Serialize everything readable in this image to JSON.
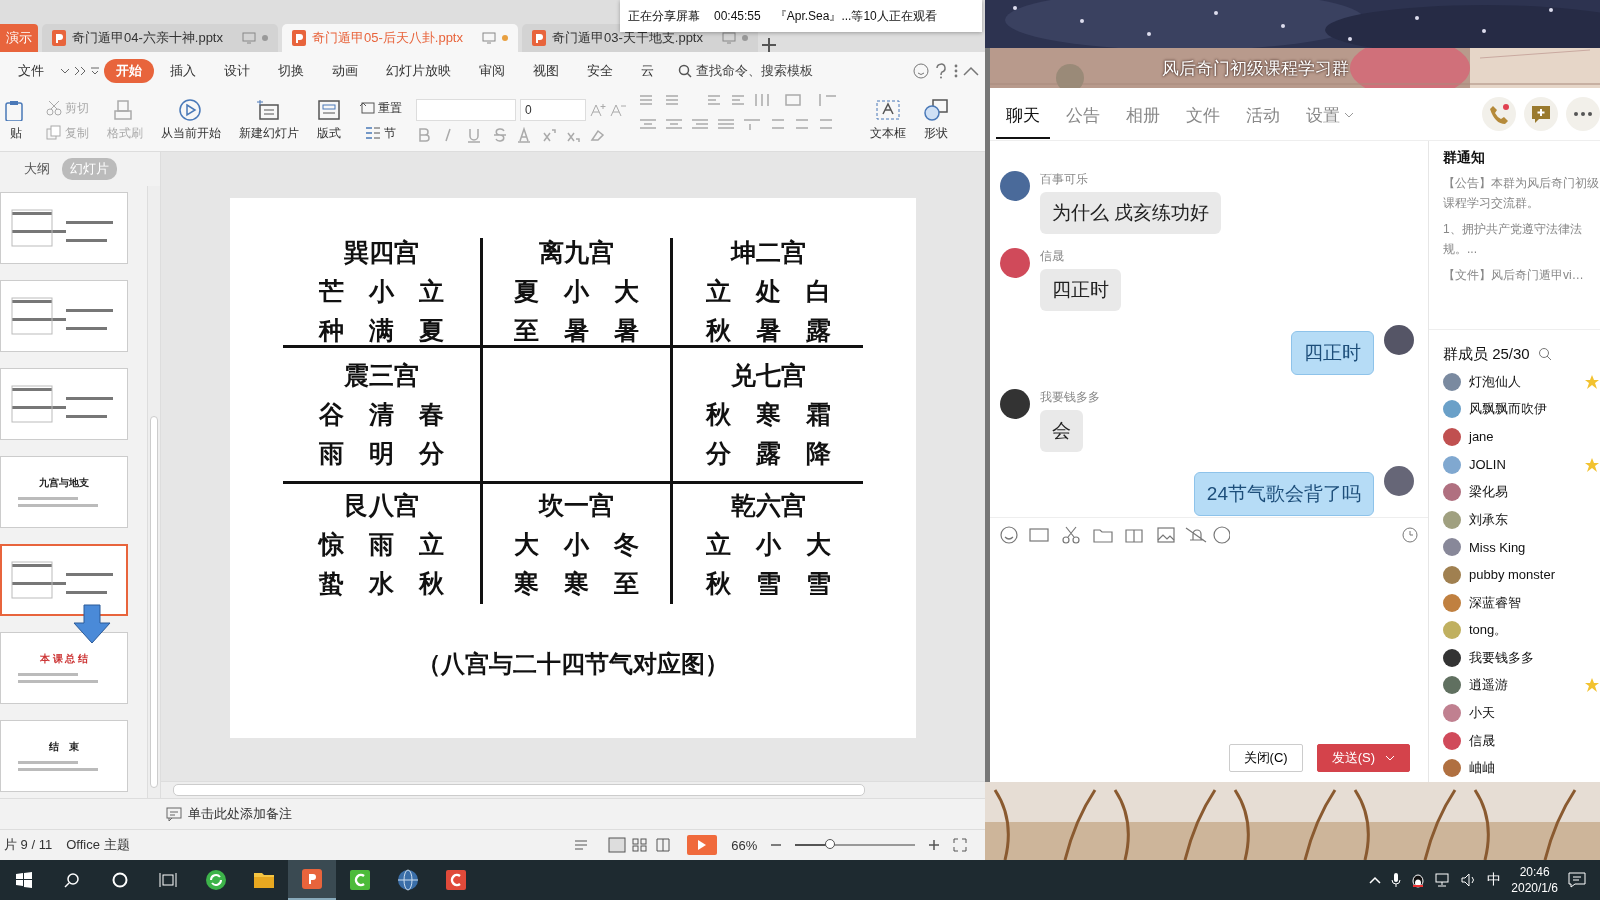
{
  "sharing_bar": {
    "status": "正在分享屏幕",
    "elapsed": "00:45:55",
    "viewers": "『Apr.Sea』...等10人正在观看"
  },
  "wps": {
    "app_tab": "演示",
    "doc_tabs": [
      {
        "title": "奇门遁甲04-六亲十神.pptx",
        "selected": false,
        "modified": false
      },
      {
        "title": "奇门遁甲05-后天八卦.pptx",
        "selected": true,
        "modified": true
      },
      {
        "title": "奇门遁甲03-天干地支.pptx",
        "selected": false,
        "modified": false
      }
    ],
    "menu": [
      {
        "label": "文件",
        "selected": false
      },
      {
        "label": "开始",
        "selected": true
      },
      {
        "label": "插入",
        "selected": false
      },
      {
        "label": "设计",
        "selected": false
      },
      {
        "label": "切换",
        "selected": false
      },
      {
        "label": "动画",
        "selected": false
      },
      {
        "label": "幻灯片放映",
        "selected": false
      },
      {
        "label": "审阅",
        "selected": false
      },
      {
        "label": "视图",
        "selected": false
      },
      {
        "label": "安全",
        "selected": false
      },
      {
        "label": "云",
        "selected": false
      }
    ],
    "search": {
      "placeholder": "查找命令、搜索模板"
    },
    "ribbon": [
      {
        "label": "贴",
        "kind": "large",
        "disabled": false
      },
      {
        "label": "剪切",
        "kind": "small",
        "disabled": true
      },
      {
        "label": "复制",
        "kind": "small",
        "disabled": true
      },
      {
        "label": "格式刷",
        "kind": "large",
        "disabled": true
      },
      {
        "label": "从当前开始",
        "kind": "large",
        "disabled": false
      },
      {
        "label": "新建幻灯片",
        "kind": "large",
        "disabled": false
      },
      {
        "label": "版式",
        "kind": "large",
        "disabled": false
      },
      {
        "label": "重置",
        "kind": "small",
        "disabled": false
      },
      {
        "label": "节",
        "kind": "small",
        "disabled": false
      },
      {
        "kind": "font",
        "size": "0"
      },
      {
        "kind": "paragraph"
      },
      {
        "label": "文本框",
        "kind": "large",
        "disabled": false
      },
      {
        "label": "形状",
        "kind": "large",
        "disabled": false
      }
    ],
    "pane_tabs": [
      {
        "label": "大纲",
        "selected": false
      },
      {
        "label": "幻灯片",
        "selected": true
      }
    ],
    "thumbnails": [
      {
        "selected": false
      },
      {
        "selected": false
      },
      {
        "selected": false
      },
      {
        "title": "九宫与地支",
        "selected": false
      },
      {
        "selected": true
      },
      {
        "title": "本 课 总 结",
        "selected": false
      },
      {
        "title": "结　束",
        "selected": false
      }
    ],
    "slide": {
      "cells": [
        {
          "kind": "palace",
          "title": "巽四宫",
          "lines": [
            "芒　小　立",
            "种　满　夏"
          ]
        },
        {
          "kind": "palace",
          "title": "离九宫",
          "lines": [
            "夏　小　大",
            "至　暑　暑"
          ]
        },
        {
          "kind": "palace",
          "title": "坤二宫",
          "lines": [
            "立　处　白",
            "秋　暑　露"
          ]
        },
        {
          "kind": "palace",
          "title": "震三宫",
          "lines": [
            "谷　清　春",
            "雨　明　分"
          ]
        },
        {
          "kind": "empty"
        },
        {
          "kind": "palace",
          "title": "兑七宫",
          "lines": [
            "秋　寒　霜",
            "分　露　降"
          ]
        },
        {
          "kind": "palace",
          "title": "艮八宫",
          "lines": [
            "惊　雨　立",
            "蛰　水　秋"
          ]
        },
        {
          "kind": "palace",
          "title": "坎一宫",
          "lines": [
            "大　小　冬",
            "寒　寒　至"
          ]
        },
        {
          "kind": "palace",
          "title": "乾六宫",
          "lines": [
            "立　小　大",
            "秋　雪　雪"
          ]
        }
      ],
      "caption": "（八宫与二十四节气对应图）"
    },
    "notes_placeholder": "单击此处添加备注",
    "status": {
      "slide_counter": "片 9 / 11",
      "theme": "Office 主题",
      "zoom": "66%",
      "level": 0.3
    }
  },
  "qq": {
    "group_title": "风后奇门初级课程学习群",
    "tabs": [
      {
        "label": "聊天",
        "selected": true
      },
      {
        "label": "公告",
        "selected": false
      },
      {
        "label": "相册",
        "selected": false
      },
      {
        "label": "文件",
        "selected": false
      },
      {
        "label": "活动",
        "selected": false
      },
      {
        "label": "设置",
        "selected": false
      }
    ],
    "messages": [
      {
        "sender": "百事可乐",
        "text": "为什么 戌亥练功好",
        "outgoing": false
      },
      {
        "sender": "信晟",
        "text": "四正时",
        "outgoing": false
      },
      {
        "text": "四正时",
        "outgoing": true
      },
      {
        "sender": "我要钱多多",
        "text": "会",
        "outgoing": false
      },
      {
        "text": "24节气歌会背了吗",
        "outgoing": true
      }
    ],
    "buttons": [
      {
        "label": "关闭(C)",
        "kind": "plain"
      },
      {
        "label": "发送(S)",
        "kind": "primary"
      }
    ],
    "notice": {
      "title": "群通知",
      "lines": [
        "【公告】本群为风后奇门初级课程学习交流群。",
        "1、拥护共产党遵守法律法规。...",
        "【文件】风后奇门遁甲vi…"
      ]
    },
    "members": {
      "title": "群成员 25/30",
      "items": [
        {
          "name": "灯泡仙人",
          "admin": true
        },
        {
          "name": "风飘飘而吹伊",
          "admin": false
        },
        {
          "name": "jane",
          "admin": false
        },
        {
          "name": "JOLIN",
          "admin": true
        },
        {
          "name": "梁化易",
          "admin": false
        },
        {
          "name": "刘承东",
          "admin": false
        },
        {
          "name": "Miss  King",
          "admin": false
        },
        {
          "name": "pubby monster",
          "admin": false
        },
        {
          "name": "深蓝睿智",
          "admin": false
        },
        {
          "name": "tong。",
          "admin": false
        },
        {
          "name": "我要钱多多",
          "admin": false
        },
        {
          "name": "逍遥游",
          "admin": true
        },
        {
          "name": "小天",
          "admin": false
        },
        {
          "name": "信晟",
          "admin": false
        },
        {
          "name": "岫岫",
          "admin": false
        }
      ]
    }
  },
  "taskbar": {
    "apps": [
      {
        "active": false
      },
      {
        "active": false
      },
      {
        "active": true
      },
      {
        "active": false
      },
      {
        "active": false
      },
      {
        "active": false
      }
    ],
    "ime": "中",
    "time": "20:46",
    "date": "2020/1/6"
  }
}
